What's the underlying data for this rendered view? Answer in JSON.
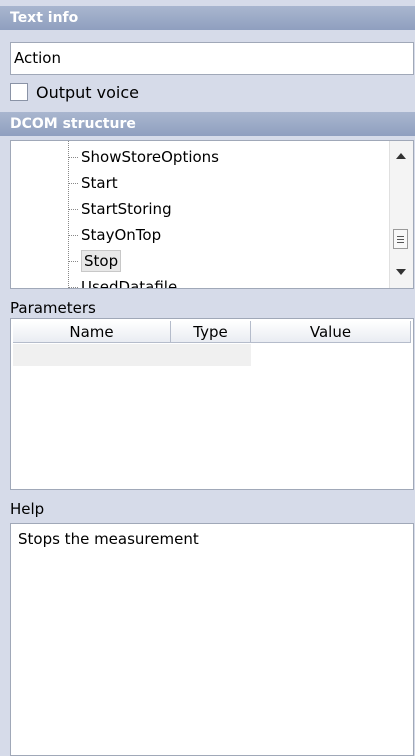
{
  "text_info": {
    "header": "Text info",
    "value": "Action",
    "output_voice_label": "Output voice",
    "output_voice_checked": false
  },
  "dcom": {
    "header": "DCOM structure",
    "items": [
      {
        "label": "ShowStoreOptions",
        "selected": false
      },
      {
        "label": "Start",
        "selected": false
      },
      {
        "label": "StartStoring",
        "selected": false
      },
      {
        "label": "StayOnTop",
        "selected": false
      },
      {
        "label": "Stop",
        "selected": true
      },
      {
        "label": "UsedDatafile",
        "selected": false
      }
    ]
  },
  "parameters": {
    "label": "Parameters",
    "columns": [
      "Name",
      "Type",
      "Value"
    ]
  },
  "help": {
    "label": "Help",
    "text": "Stops the measurement"
  }
}
